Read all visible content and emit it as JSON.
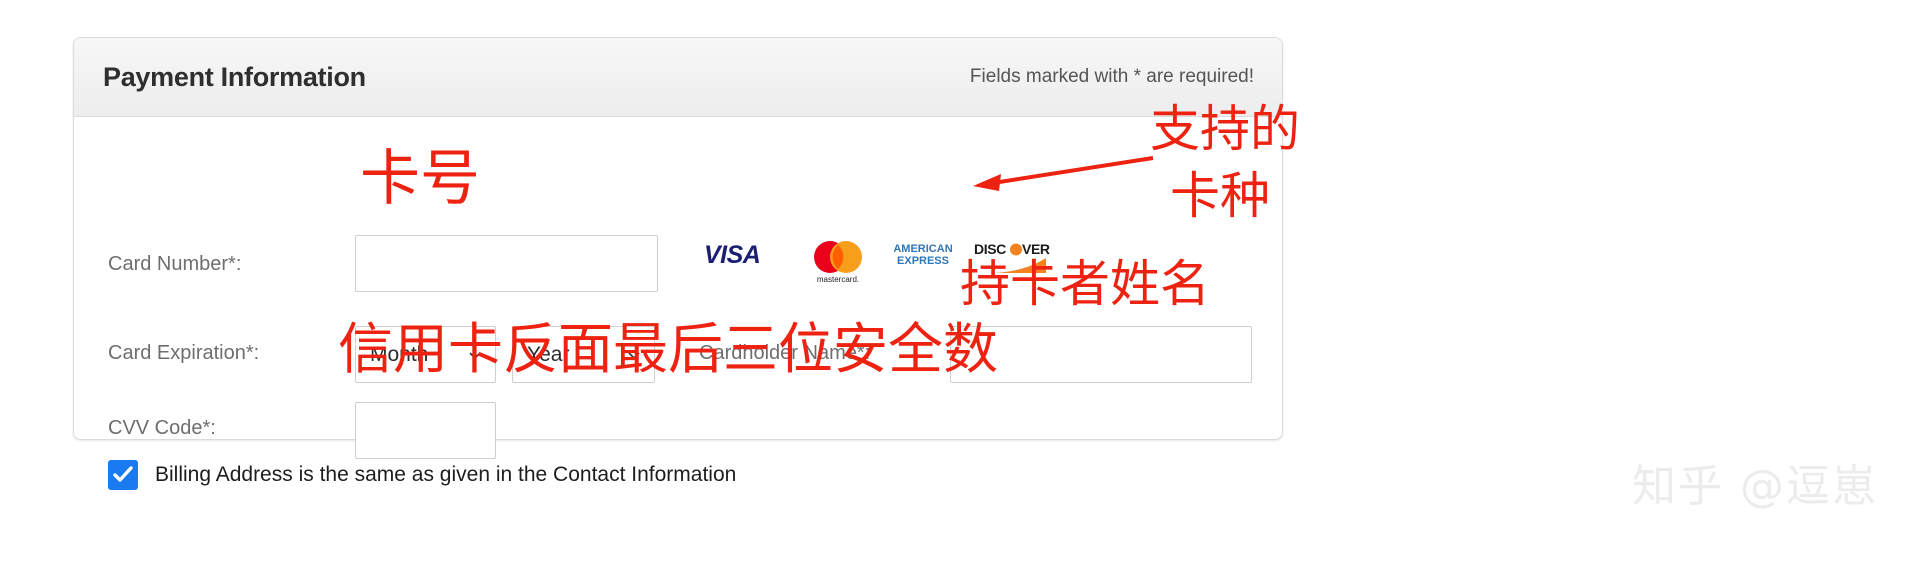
{
  "panel": {
    "title": "Payment Information",
    "required_note": "Fields marked with * are required!"
  },
  "fields": {
    "card_number": {
      "label": "Card Number*:",
      "value": "",
      "placeholder": ""
    },
    "card_expiration": {
      "label": "Card Expiration*:",
      "month_selected": "Month",
      "year_selected": "Year"
    },
    "cardholder_name": {
      "label": "Cardholder Name*:",
      "value": "",
      "placeholder": ""
    },
    "cvv_code": {
      "label": "CVV Code*:",
      "value": "",
      "placeholder": ""
    }
  },
  "billing": {
    "label": "Billing Address is the same as given in the Contact Information",
    "checked": true
  },
  "card_logos": [
    {
      "name": "visa-logo",
      "text": "VISA"
    },
    {
      "name": "mastercard-logo",
      "text": "mastercard"
    },
    {
      "name": "amex-logo",
      "line1": "AMERICAN",
      "line2": "EXPRESS"
    },
    {
      "name": "discover-logo",
      "text": "DISCOVER"
    }
  ],
  "annotations": {
    "card_number": "卡号",
    "supported_cards_line1": "支持的",
    "supported_cards_line2": "卡种",
    "cardholder_name": "持卡者姓名",
    "cvv_code": "信用卡反面最后三位安全数"
  },
  "watermark": "知乎 @逗崽",
  "colors": {
    "annotation_red": "#ee2211",
    "checkbox_blue": "#1a7bf0",
    "visa_blue": "#1a1f71",
    "mastercard_red": "#eb001b",
    "mastercard_orange": "#f79e1b",
    "amex_blue": "#2e77bb",
    "discover_orange": "#f58220",
    "panel_border": "#dcdcdc",
    "label_gray": "#6e6e6e"
  }
}
